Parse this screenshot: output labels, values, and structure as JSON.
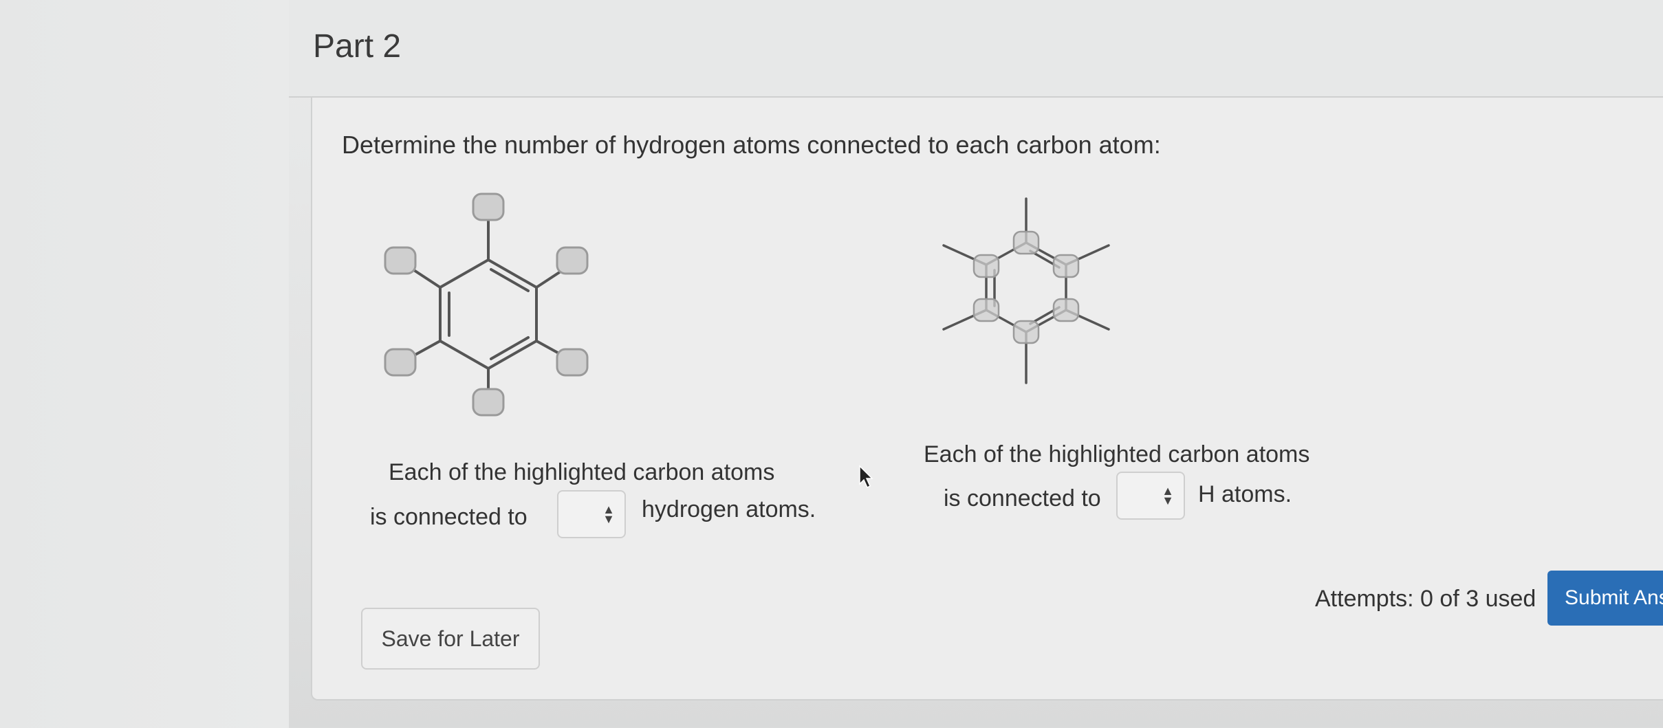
{
  "header": {
    "part_title": "Part 2"
  },
  "question": {
    "text": "Determine the number of hydrogen atoms connected to each carbon atom:"
  },
  "answers": {
    "left": {
      "line1": "Each of the highlighted carbon atoms",
      "prefix": "is connected to",
      "selected": "",
      "suffix": "hydrogen atoms."
    },
    "right": {
      "line1": "Each of the highlighted carbon atoms",
      "prefix": "is connected to",
      "selected": "",
      "suffix": "H atoms."
    }
  },
  "footer": {
    "save_label": "Save for Later",
    "attempts": "Attempts: 0 of 3 used",
    "submit_label": "Submit Ans"
  },
  "colors": {
    "accent": "#2a6eb6",
    "highlight": "#c9c9c9",
    "bond": "#555555"
  },
  "icons": [
    "updown-arrows-icon",
    "mouse-pointer-icon"
  ]
}
